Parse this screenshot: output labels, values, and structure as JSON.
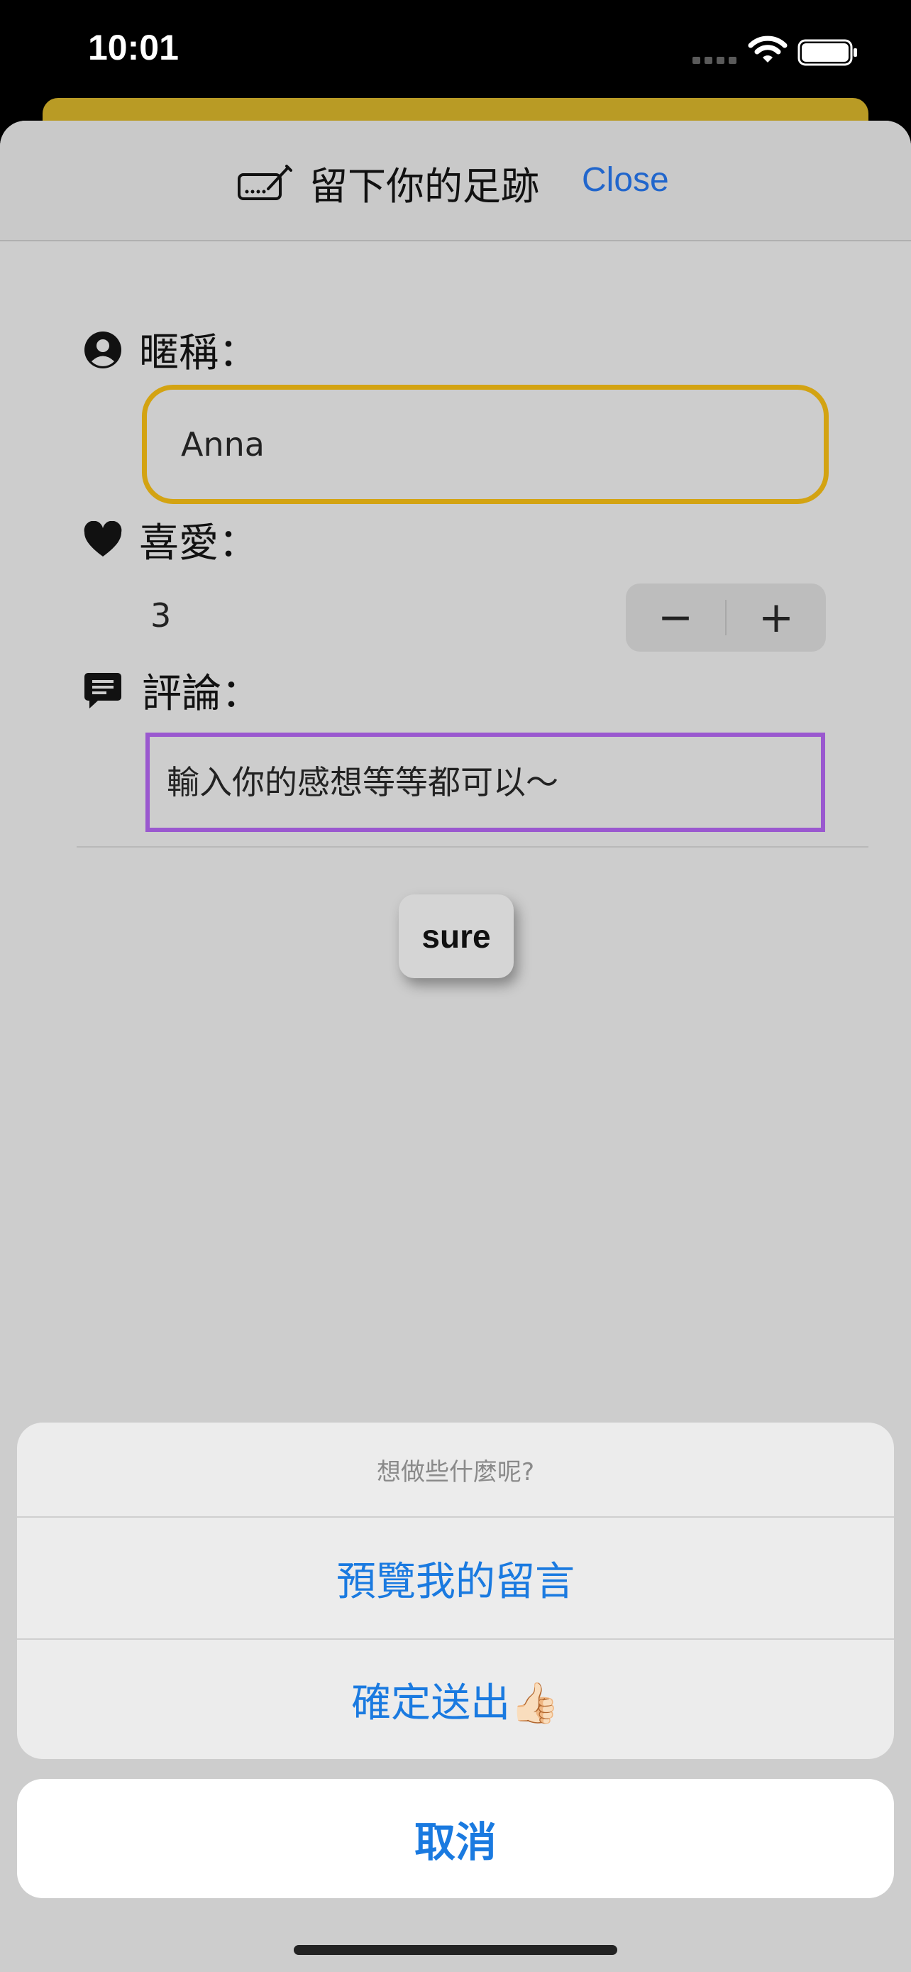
{
  "status_bar": {
    "time": "10:01",
    "icons": [
      "signal-dots-icon",
      "wifi-icon",
      "battery-icon"
    ]
  },
  "nav": {
    "icon": "signature-icon",
    "title": "留下你的足跡",
    "close_label": "Close"
  },
  "form": {
    "nickname": {
      "label": "暱稱：",
      "icon": "person-circle-icon",
      "value": "Anna"
    },
    "likes": {
      "label": "喜愛：",
      "icon": "heart-icon",
      "count": "3",
      "decrement": "−",
      "increment": "+"
    },
    "comment": {
      "label": "評論：",
      "icon": "message-icon",
      "placeholder": "輸入你的感想等等都可以～"
    },
    "submit_label": "sure"
  },
  "action_sheet": {
    "title": "想做些什麼呢?",
    "actions": [
      "預覽我的留言",
      "確定送出👍🏻"
    ],
    "cancel_label": "取消"
  },
  "colors": {
    "nickname_border": "#d3a312",
    "comment_border": "#9a58cf",
    "action_blue": "#1a7ae0",
    "close_blue": "#2166cc"
  }
}
